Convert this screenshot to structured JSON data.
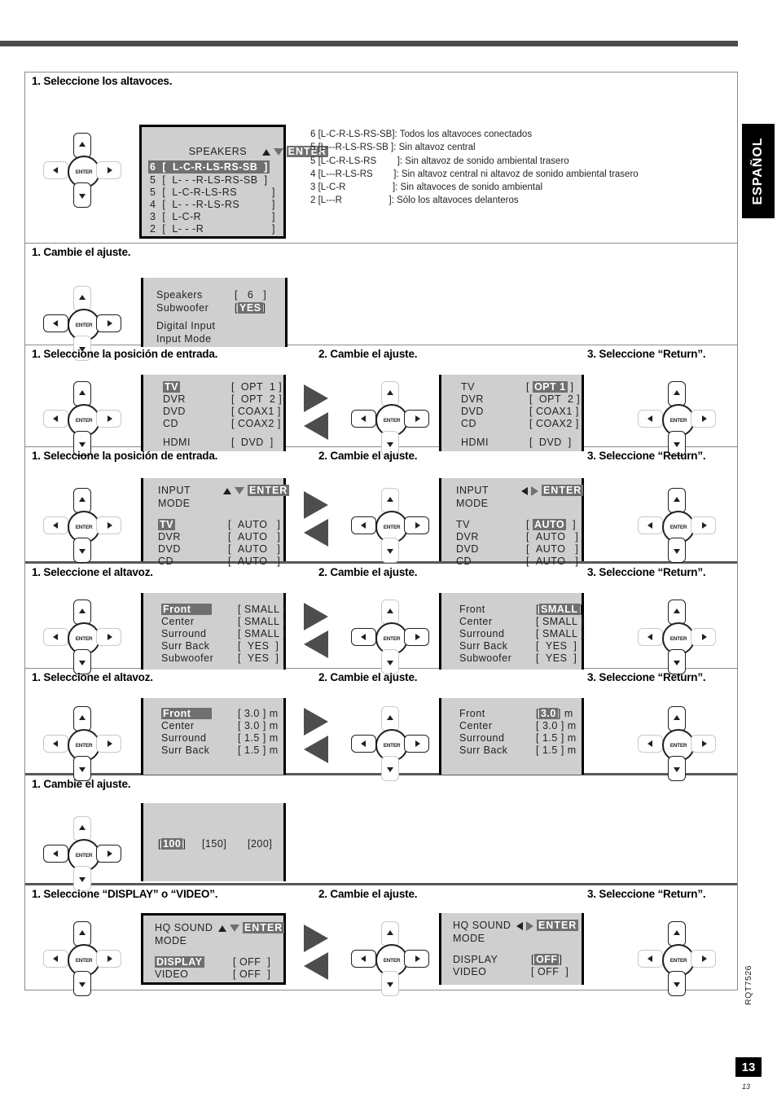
{
  "side_tab": {
    "label": "ESPAÑOL"
  },
  "footer": {
    "doc_code": "RQT7526",
    "page_box": "13",
    "page_small": "13"
  },
  "sections": [
    {
      "id": "speakers",
      "heads": [
        "1. Seleccione los altavoces."
      ],
      "osd": {
        "title": "SPEAKERS",
        "enter": "ENTER",
        "rows": [
          {
            "num": "6",
            "open": "[",
            "text": "L-C-R-LS-RS-SB",
            "close": "]",
            "selected": true
          },
          {
            "num": "5",
            "open": "[",
            "text": "L- - -R-LS-RS-SB",
            "close": "]",
            "selected": false
          },
          {
            "num": "5",
            "open": "[",
            "text": "L-C-R-LS-RS",
            "close": "]",
            "selected": false
          },
          {
            "num": "4",
            "open": "[",
            "text": "L- - -R-LS-RS",
            "close": "]",
            "selected": false
          },
          {
            "num": "3",
            "open": "[",
            "text": "L-C-R",
            "close": "]",
            "selected": false
          },
          {
            "num": "2",
            "open": "[",
            "text": "L- - -R",
            "close": "]",
            "selected": false
          }
        ]
      },
      "legend": [
        "6 [L-C-R-LS-RS-SB]: Todos los altavoces conectados",
        "5 [L---R-LS-RS-SB ]: Sin altavoz central",
        "5 [L-C-R-LS-RS        ]: Sin altavoz de sonido ambiental trasero",
        "4 [L---R-LS-RS        ]: Sin altavoz central ni altavoz de sonido ambiental trasero",
        "3 [L-C-R                  ]: Sin altavoces de sonido ambiental",
        "2 [L---R                  ]: Sólo los altavoces delanteros"
      ]
    },
    {
      "id": "subwoofer",
      "heads": [
        "1. Cambie el ajuste."
      ],
      "osd_rows": [
        {
          "label": "Speakers",
          "open": "[",
          "value": "6",
          "close": "]",
          "highlight": false
        },
        {
          "label": "Subwoofer",
          "open": "[",
          "value": "YES",
          "close": "]",
          "highlight": true
        },
        {
          "label": "",
          "open": "",
          "value": "",
          "close": "",
          "highlight": false
        },
        {
          "label": "Digital Input",
          "open": "",
          "value": "",
          "close": "",
          "highlight": false
        },
        {
          "label": "Input Mode",
          "open": "",
          "value": "",
          "close": "",
          "highlight": false
        }
      ]
    },
    {
      "id": "digital-input",
      "heads": [
        "1. Seleccione la posición de entrada.",
        "2. Cambie el ajuste.",
        "3. Seleccione “Return”."
      ],
      "left_rows": [
        {
          "label": "TV",
          "open": "[",
          "value": "OPT  1",
          "close": "]",
          "label_hl": true,
          "value_hl": false
        },
        {
          "label": "DVR",
          "open": "[",
          "value": "OPT  2",
          "close": "]",
          "label_hl": false,
          "value_hl": false
        },
        {
          "label": "DVD",
          "open": "[",
          "value": "COAX1",
          "close": "]",
          "label_hl": false,
          "value_hl": false
        },
        {
          "label": "CD",
          "open": "[",
          "value": "COAX2",
          "close": "]",
          "label_hl": false,
          "value_hl": false
        },
        {
          "label": "",
          "open": "",
          "value": "",
          "close": "",
          "label_hl": false,
          "value_hl": false
        },
        {
          "label": "HDMI",
          "open": "[",
          "value": "DVD",
          "close": "]",
          "label_hl": false,
          "value_hl": false
        }
      ],
      "right_rows": [
        {
          "label": "TV",
          "open": "[",
          "value": "OPT 1",
          "close": "]",
          "label_hl": false,
          "value_hl": true
        },
        {
          "label": "DVR",
          "open": "[",
          "value": "OPT  2",
          "close": "]",
          "label_hl": false,
          "value_hl": false
        },
        {
          "label": "DVD",
          "open": "[",
          "value": "COAX1",
          "close": "]",
          "label_hl": false,
          "value_hl": false
        },
        {
          "label": "CD",
          "open": "[",
          "value": "COAX2",
          "close": "]",
          "label_hl": false,
          "value_hl": false
        },
        {
          "label": "",
          "open": "",
          "value": "",
          "close": "",
          "label_hl": false,
          "value_hl": false
        },
        {
          "label": "HDMI",
          "open": "[",
          "value": "DVD",
          "close": "]",
          "label_hl": false,
          "value_hl": false
        }
      ]
    },
    {
      "id": "input-mode",
      "heads": [
        "1. Seleccione la posición de entrada.",
        "2. Cambie el ajuste.",
        "3. Seleccione “Return”."
      ],
      "title_line1": "INPUT",
      "title_line2": "MODE",
      "enter": "ENTER",
      "left_rows": [
        {
          "label": "TV",
          "open": "[",
          "value": "AUTO",
          "close": "]",
          "label_hl": true,
          "value_hl": false
        },
        {
          "label": "DVR",
          "open": "[",
          "value": "AUTO",
          "close": "]",
          "label_hl": false,
          "value_hl": false
        },
        {
          "label": "DVD",
          "open": "[",
          "value": "AUTO",
          "close": "]",
          "label_hl": false,
          "value_hl": false
        },
        {
          "label": "CD",
          "open": "[",
          "value": "AUTO",
          "close": "]",
          "label_hl": false,
          "value_hl": false
        }
      ],
      "right_rows": [
        {
          "label": "TV",
          "open": "[",
          "value": "AUTO",
          "close": "]",
          "label_hl": false,
          "value_hl": true
        },
        {
          "label": "DVR",
          "open": "[",
          "value": "AUTO",
          "close": "]",
          "label_hl": false,
          "value_hl": false
        },
        {
          "label": "DVD",
          "open": "[",
          "value": "AUTO",
          "close": "]",
          "label_hl": false,
          "value_hl": false
        },
        {
          "label": "CD",
          "open": "[",
          "value": "AUTO",
          "close": "]",
          "label_hl": false,
          "value_hl": false
        }
      ]
    },
    {
      "id": "speaker-size",
      "heads": [
        "1. Seleccione el altavoz.",
        "2. Cambie el ajuste.",
        "3. Seleccione “Return”."
      ],
      "left_rows": [
        {
          "label": "Front",
          "open": "[",
          "value": "SMALL",
          "close": "]",
          "label_hl": true,
          "value_hl": false
        },
        {
          "label": "Center",
          "open": "[",
          "value": "SMALL",
          "close": "]",
          "label_hl": false,
          "value_hl": false
        },
        {
          "label": "Surround",
          "open": "[",
          "value": "SMALL",
          "close": "]",
          "label_hl": false,
          "value_hl": false
        },
        {
          "label": "Surr Back",
          "open": "[",
          "value": "YES",
          "close": "]",
          "label_hl": false,
          "value_hl": false
        },
        {
          "label": "Subwoofer",
          "open": "[",
          "value": "YES",
          "close": "]",
          "label_hl": false,
          "value_hl": false
        }
      ],
      "right_rows": [
        {
          "label": "Front",
          "open": "[",
          "value": "SMALL",
          "close": "]",
          "label_hl": false,
          "value_hl": true
        },
        {
          "label": "Center",
          "open": "[",
          "value": "SMALL",
          "close": "]",
          "label_hl": false,
          "value_hl": false
        },
        {
          "label": "Surround",
          "open": "[",
          "value": "SMALL",
          "close": "]",
          "label_hl": false,
          "value_hl": false
        },
        {
          "label": "Surr Back",
          "open": "[",
          "value": "YES",
          "close": "]",
          "label_hl": false,
          "value_hl": false
        },
        {
          "label": "Subwoofer",
          "open": "[",
          "value": "YES",
          "close": "]",
          "label_hl": false,
          "value_hl": false
        }
      ]
    },
    {
      "id": "speaker-distance",
      "heads": [
        "1. Seleccione el altavoz.",
        "2. Cambie el ajuste.",
        "3. Seleccione “Return”."
      ],
      "unit": "m",
      "left_rows": [
        {
          "label": "Front",
          "open": "[",
          "value": "3.0",
          "close": "]",
          "label_hl": true,
          "value_hl": false
        },
        {
          "label": "Center",
          "open": "[",
          "value": "3.0",
          "close": "]",
          "label_hl": false,
          "value_hl": false
        },
        {
          "label": "Surround",
          "open": "[",
          "value": "1.5",
          "close": "]",
          "label_hl": false,
          "value_hl": false
        },
        {
          "label": "Surr Back",
          "open": "[",
          "value": "1.5",
          "close": "]",
          "label_hl": false,
          "value_hl": false
        }
      ],
      "right_rows": [
        {
          "label": "Front",
          "open": "[",
          "value": "3.0",
          "close": "]",
          "label_hl": false,
          "value_hl": true
        },
        {
          "label": "Center",
          "open": "[",
          "value": "3.0",
          "close": "]",
          "label_hl": false,
          "value_hl": false
        },
        {
          "label": "Surround",
          "open": "[",
          "value": "1.5",
          "close": "]",
          "label_hl": false,
          "value_hl": false
        },
        {
          "label": "Surr Back",
          "open": "[",
          "value": "1.5",
          "close": "]",
          "label_hl": false,
          "value_hl": false
        }
      ]
    },
    {
      "id": "crossover",
      "heads": [
        "1. Cambie el ajuste."
      ],
      "options": [
        {
          "open": "[",
          "value": "100",
          "close": "]",
          "highlight": true
        },
        {
          "open": "[",
          "value": "150",
          "close": "]",
          "highlight": false
        },
        {
          "open": "[",
          "value": "200",
          "close": "]",
          "highlight": false
        }
      ]
    },
    {
      "id": "hq-sound",
      "heads": [
        "1. Seleccione “DISPLAY” o “VIDEO”.",
        "2. Cambie el ajuste.",
        "3. Seleccione “Return”."
      ],
      "title_line1": "HQ SOUND",
      "title_line2": "MODE",
      "enter": "ENTER",
      "left_rows": [
        {
          "label": "DISPLAY",
          "open": "[",
          "value": "OFF",
          "close": "]",
          "label_hl": true,
          "value_hl": false
        },
        {
          "label": "VIDEO",
          "open": "[",
          "value": "OFF",
          "close": "]",
          "label_hl": false,
          "value_hl": false
        }
      ],
      "right_rows": [
        {
          "label": "DISPLAY",
          "open": "[",
          "value": "OFF",
          "close": "]",
          "label_hl": false,
          "value_hl": true
        },
        {
          "label": "VIDEO",
          "open": "[",
          "value": "OFF",
          "close": "]",
          "label_hl": false,
          "value_hl": false
        }
      ]
    }
  ]
}
